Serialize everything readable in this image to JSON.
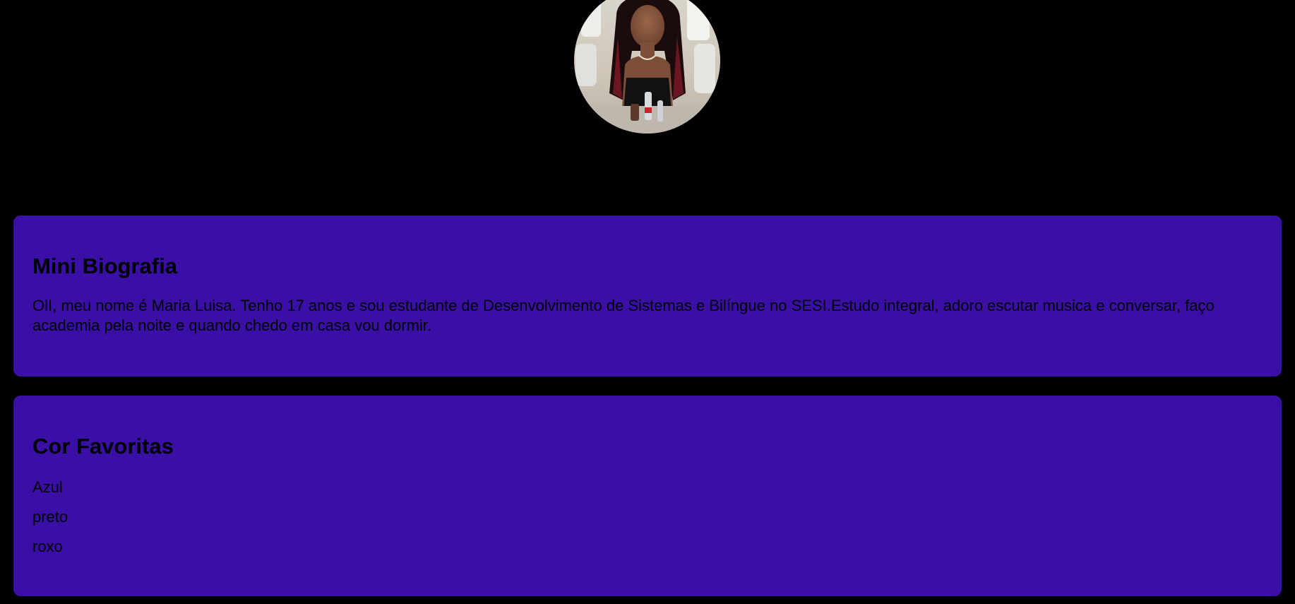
{
  "profile": {
    "photo_alt": "Maria Luisa"
  },
  "bio": {
    "title": "Mini Biografia",
    "text": "OlI, meu nome é Maria Luisa. Tenho 17 anos e sou estudante de Desenvolvimento de Sistemas e Bilíngue no SESI.Estudo integral, adoro escutar musica e conversar, faço academia pela noite e quando chedo em casa vou dormir."
  },
  "favorites": {
    "title": "Cor Favoritas",
    "items": [
      "Azul",
      "preto",
      "roxo"
    ]
  },
  "colors": {
    "background": "#000000",
    "card": "#3a0fa6",
    "text": "#000000"
  }
}
